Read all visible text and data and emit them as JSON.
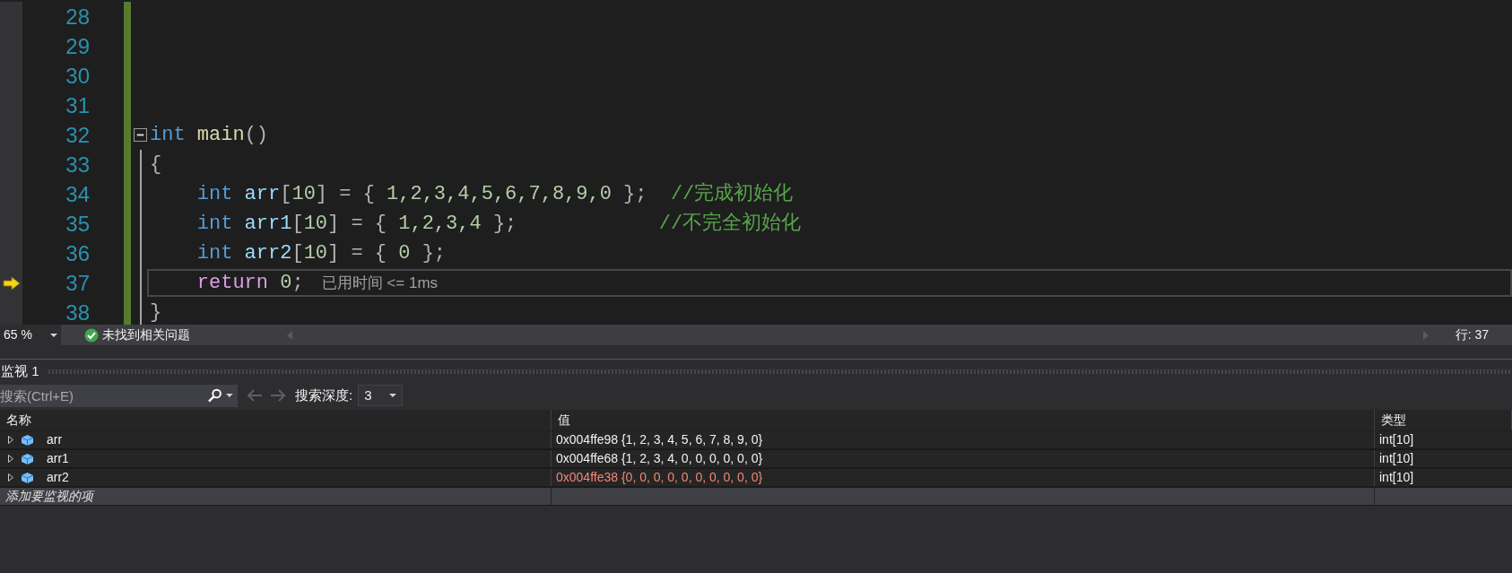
{
  "editor": {
    "lines": [
      {
        "number": "28",
        "kind": "plain",
        "current": false
      },
      {
        "number": "29",
        "kind": "plain",
        "current": false
      },
      {
        "number": "30",
        "kind": "plain",
        "current": false
      },
      {
        "number": "31",
        "kind": "plain",
        "current": false
      },
      {
        "number": "32",
        "kind": "header",
        "current": false,
        "tokens": [
          {
            "kind": "keyword",
            "text": "int"
          },
          {
            "kind": "function",
            "text": " main"
          },
          {
            "kind": "punct",
            "text": "()"
          }
        ]
      },
      {
        "number": "33",
        "kind": "body",
        "current": false,
        "tokens": [
          {
            "kind": "punct",
            "text": "{"
          }
        ]
      },
      {
        "number": "34",
        "kind": "body",
        "current": false,
        "tokens": [
          {
            "kind": "keyword",
            "text": "    int"
          },
          {
            "kind": "variable",
            "text": " arr"
          },
          {
            "kind": "punct",
            "text": "["
          },
          {
            "kind": "number",
            "text": "10"
          },
          {
            "kind": "punct",
            "text": "] = { "
          },
          {
            "kind": "number",
            "text": "1,2,3,4,5,6,7,8,9,0"
          },
          {
            "kind": "punct",
            "text": " };"
          },
          {
            "kind": "comment",
            "text": "  //完成初始化"
          }
        ]
      },
      {
        "number": "35",
        "kind": "body",
        "current": false,
        "tokens": [
          {
            "kind": "keyword",
            "text": "    int"
          },
          {
            "kind": "variable",
            "text": " arr1"
          },
          {
            "kind": "punct",
            "text": "["
          },
          {
            "kind": "number",
            "text": "10"
          },
          {
            "kind": "punct",
            "text": "] = { "
          },
          {
            "kind": "number",
            "text": "1,2,3,4"
          },
          {
            "kind": "punct",
            "text": " };"
          },
          {
            "kind": "comment",
            "text": "            //不完全初始化"
          }
        ]
      },
      {
        "number": "36",
        "kind": "body",
        "current": false,
        "tokens": [
          {
            "kind": "keyword",
            "text": "    int"
          },
          {
            "kind": "variable",
            "text": " arr2"
          },
          {
            "kind": "punct",
            "text": "["
          },
          {
            "kind": "number",
            "text": "10"
          },
          {
            "kind": "punct",
            "text": "] = { "
          },
          {
            "kind": "number",
            "text": "0"
          },
          {
            "kind": "punct",
            "text": " };"
          }
        ]
      },
      {
        "number": "37",
        "kind": "body",
        "current": true,
        "tip": "已用时间 <= 1ms",
        "tokens": [
          {
            "kind": "control",
            "text": "    return"
          },
          {
            "kind": "number",
            "text": " 0"
          },
          {
            "kind": "punct",
            "text": ";"
          }
        ]
      },
      {
        "number": "38",
        "kind": "footer",
        "current": false,
        "tokens": [
          {
            "kind": "punct",
            "text": "}"
          }
        ]
      }
    ]
  },
  "status_bar": {
    "zoom": "65 %",
    "issues": "未找到相关问题",
    "line": "行: 37"
  },
  "watch": {
    "title": "监视 1",
    "search": {
      "placeholder": "搜索(Ctrl+E)"
    },
    "depth_label": "搜索深度:",
    "depth": "3",
    "columns": [
      "名称",
      "值",
      "类型"
    ],
    "rows": [
      {
        "name": "arr",
        "value": "0x004ffe98 {1, 2, 3, 4, 5, 6, 7, 8, 9, 0}",
        "type": "int[10]",
        "changed": false
      },
      {
        "name": "arr1",
        "value": "0x004ffe68 {1, 2, 3, 4, 0, 0, 0, 0, 0, 0}",
        "type": "int[10]",
        "changed": false
      },
      {
        "name": "arr2",
        "value": "0x004ffe38 {0, 0, 0, 0, 0, 0, 0, 0, 0, 0}",
        "type": "int[10]",
        "changed": true
      }
    ],
    "add_placeholder": "添加要监视的项"
  }
}
